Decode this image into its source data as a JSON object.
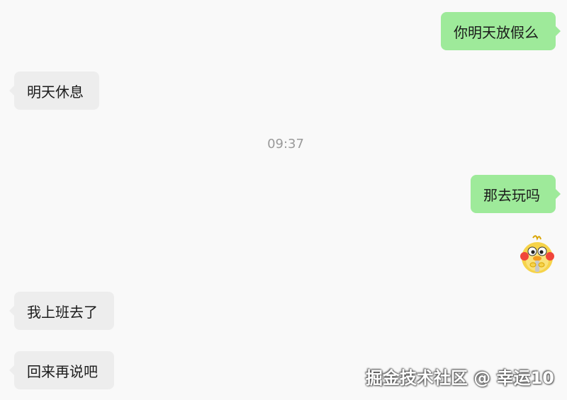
{
  "messages": [
    {
      "text": "你明天放假么",
      "side": "sent"
    },
    {
      "text": "明天休息",
      "side": "received"
    },
    {
      "text": "那去玩吗",
      "side": "sent"
    },
    {
      "sticker": "duck-sticker",
      "side": "sent"
    },
    {
      "text": "我上班去了",
      "side": "received"
    },
    {
      "text": "回来再说吧",
      "side": "received"
    }
  ],
  "timestamp": "09:37",
  "watermark": "掘金技术社区 @ 幸运10",
  "colors": {
    "background": "#f9f9f9",
    "sent_bubble": "#9eea9a",
    "received_bubble": "#ededed",
    "timestamp": "#9a9a9a"
  }
}
